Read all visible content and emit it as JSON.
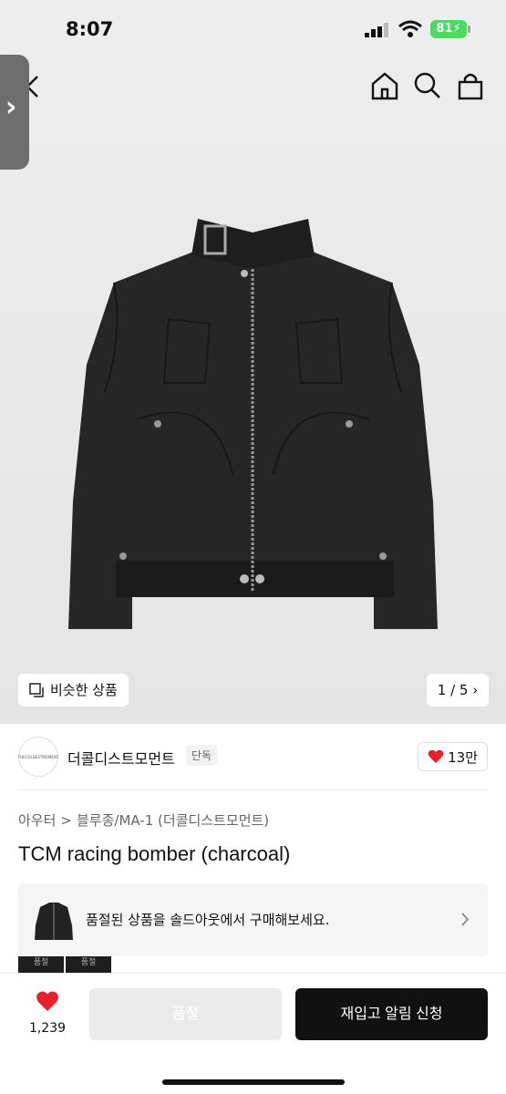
{
  "status_bar": {
    "time": "8:07",
    "battery": "81"
  },
  "nav": {
    "back_icon": "chevron-left-icon",
    "home_icon": "home-icon",
    "search_icon": "search-icon",
    "bag_icon": "shopping-bag-icon",
    "side_tab_glyph": "›"
  },
  "gallery": {
    "similar_label": "비슷한 상품",
    "pager": "1 / 5 ›"
  },
  "brand": {
    "name": "더콜디스트모먼트",
    "tag": "단독",
    "logo_text": "THECOLDESTMOMENT",
    "likes": "13만"
  },
  "breadcrumb": {
    "category": "아우터",
    "separator": ">",
    "sub": "블루종/MA-1 (더콜디스트모먼트)"
  },
  "product": {
    "title": "TCM racing bomber (charcoal)"
  },
  "soldout_banner": {
    "text": "품절된 상품을 솔드아웃에서 구매해보세요."
  },
  "mini_thumbs": [
    "품절",
    "품절"
  ],
  "bottom": {
    "fav_count": "1,239",
    "soldout_button": "품절",
    "restock_button": "재입고 알림 신청"
  },
  "colors": {
    "accent_red": "#e8202a",
    "battery_green": "#4cd964",
    "primary_black": "#111111"
  }
}
